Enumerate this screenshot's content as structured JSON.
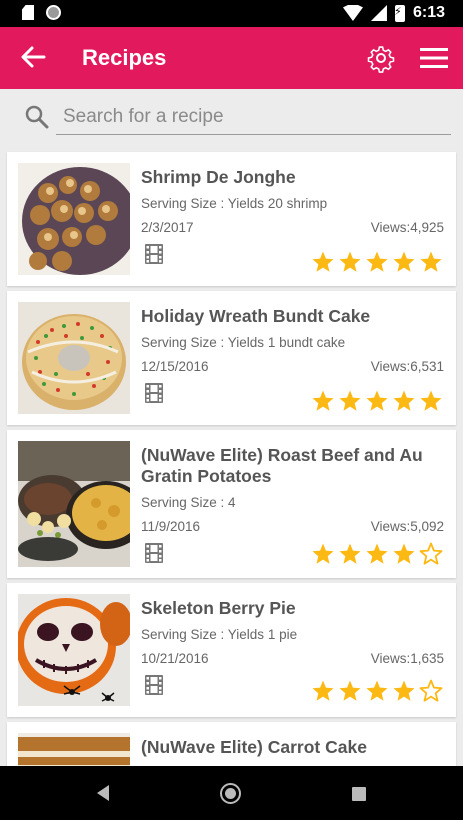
{
  "status_bar": {
    "time": "6:13"
  },
  "header": {
    "title": "Recipes"
  },
  "search": {
    "placeholder": "Search for a recipe",
    "value": ""
  },
  "recipes": [
    {
      "title": "Shrimp De Jonghe",
      "serving": "Serving Size : Yields 20 shrimp",
      "date": "2/3/2017",
      "views": "Views:4,925",
      "rating": 5,
      "rating_max": 5
    },
    {
      "title": "Holiday Wreath Bundt Cake",
      "serving": "Serving Size : Yields 1 bundt cake",
      "date": "12/15/2016",
      "views": "Views:6,531",
      "rating": 5,
      "rating_max": 5
    },
    {
      "title": "(NuWave Elite) Roast Beef and Au Gratin Potatoes",
      "serving": "Serving Size : 4",
      "date": "11/9/2016",
      "views": "Views:5,092",
      "rating": 4,
      "rating_max": 5
    },
    {
      "title": "Skeleton Berry Pie",
      "serving": "Serving Size : Yields 1 pie",
      "date": "10/21/2016",
      "views": "Views:1,635",
      "rating": 4,
      "rating_max": 5
    },
    {
      "title": "(NuWave Elite) Carrot Cake"
    }
  ],
  "colors": {
    "primary": "#e3195e",
    "star": "#fdb913",
    "text": "#555555"
  }
}
